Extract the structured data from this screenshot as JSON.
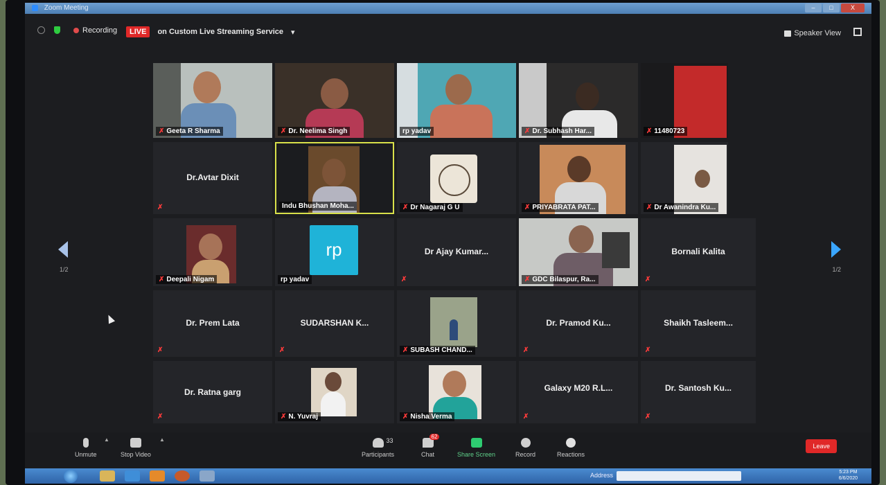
{
  "window": {
    "title": "Zoom Meeting",
    "controls": [
      "–",
      "□",
      "X"
    ]
  },
  "topbar": {
    "recording_label": "Recording",
    "live_badge": "LIVE",
    "stream_label": "on Custom Live Streaming Service",
    "stream_caret": "▾",
    "speaker_view_label": "Speaker View"
  },
  "pagination": {
    "left": "1/2",
    "right": "1/2"
  },
  "participants": [
    {
      "name": "Geeta R Sharma",
      "type": "video"
    },
    {
      "name": "Dr. Neelima Singh",
      "type": "video"
    },
    {
      "name": "rp yadav",
      "type": "video"
    },
    {
      "name": "Dr. Subhash Har...",
      "type": "video"
    },
    {
      "name": "11480723",
      "type": "video"
    },
    {
      "name": "Dr.Avtar Dixit",
      "type": "name"
    },
    {
      "name": "Indu Bhushan Moha...",
      "type": "video",
      "active": true
    },
    {
      "name": "Dr Nagaraj G U",
      "type": "seal"
    },
    {
      "name": "PRIYABRATA PAT...",
      "type": "video"
    },
    {
      "name": "Dr Awanindra Ku...",
      "type": "video"
    },
    {
      "name": "Deepali Nigam",
      "type": "video"
    },
    {
      "name": "rp yadav",
      "type": "avatar",
      "avatar_text": "rp"
    },
    {
      "name": "Dr Ajay Kumar...",
      "type": "name"
    },
    {
      "name": "GDC Bilaspur, Ra...",
      "type": "video"
    },
    {
      "name": "Bornali Kalita",
      "type": "name"
    },
    {
      "name": "Dr. Prem Lata",
      "type": "name"
    },
    {
      "name": "SUDARSHAN  K...",
      "type": "name"
    },
    {
      "name": "SUBASH CHAND...",
      "type": "video"
    },
    {
      "name": "Dr. Pramod Ku...",
      "type": "name"
    },
    {
      "name": "Shaikh  Tasleem...",
      "type": "name"
    },
    {
      "name": "Dr. Ratna garg",
      "type": "name"
    },
    {
      "name": "N. Yuvraj",
      "type": "video"
    },
    {
      "name": "Nisha Verma",
      "type": "video"
    },
    {
      "name": "Galaxy M20  R.L...",
      "type": "name"
    },
    {
      "name": "Dr. Santosh Ku...",
      "type": "name"
    }
  ],
  "toolbar": {
    "unmute": "Unmute",
    "stop_video": "Stop Video",
    "participants": "Participants",
    "participants_count": "33",
    "chat": "Chat",
    "chat_badge": "62",
    "share_screen": "Share Screen",
    "record": "Record",
    "reactions": "Reactions",
    "leave": "Leave"
  },
  "taskbar": {
    "address_label": "Address",
    "clock_time": "5:23 PM",
    "clock_date": "6/6/2020"
  },
  "colors": {
    "live": "#e02828",
    "share": "#2ecc71",
    "rp_avatar": "#1fb3d8",
    "active_border": "#d9e14a"
  }
}
